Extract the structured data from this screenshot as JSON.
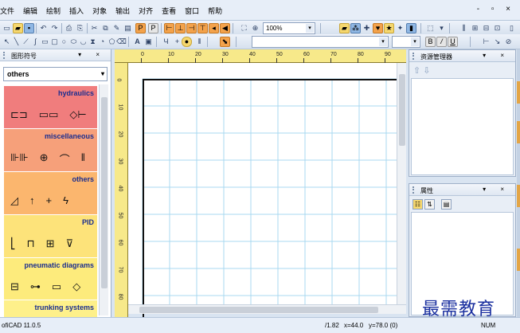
{
  "menu": {
    "items": [
      "文件",
      "编辑",
      "绘制",
      "插入",
      "对象",
      "输出",
      "对齐",
      "查看",
      "窗口",
      "帮助"
    ],
    "window_controls": "- ▫ ×"
  },
  "toolbar": {
    "zoom_value": "100%"
  },
  "left_panel": {
    "title": "图形符号",
    "controls": "▾ ×",
    "category_value": "others",
    "sections": [
      {
        "title": "hydraulics",
        "color": "#f07d7d",
        "symbols": [
          "⊏⊐",
          "▭▭",
          "◇⊢"
        ]
      },
      {
        "title": "miscellaneous",
        "color": "#f6a07a",
        "symbols": [
          "⊪⊪",
          "⊕",
          "⌒",
          "‖"
        ]
      },
      {
        "title": "others",
        "color": "#fbb66e",
        "symbols": [
          "◿",
          "↑",
          "+",
          "ϟ"
        ]
      },
      {
        "title": "PID",
        "color": "#fde37a",
        "symbols": [
          "⎣",
          "⊓",
          "⊞",
          "⊽"
        ]
      },
      {
        "title": "pneumatic diagrams",
        "color": "#fdeb7c",
        "symbols": [
          "⊟",
          "⊶",
          "▭",
          "◇"
        ]
      },
      {
        "title": "trunking systems",
        "color": "#fef08a",
        "symbols": []
      }
    ]
  },
  "ruler": {
    "top_labels": [
      "0",
      "10",
      "20",
      "30",
      "40",
      "50",
      "60",
      "70",
      "80",
      "90"
    ],
    "left_labels": [
      "0",
      "10",
      "20",
      "30",
      "40",
      "50",
      "60",
      "70",
      "80"
    ]
  },
  "right_panel_top": {
    "title": "资源管理器",
    "controls": "▾ ×"
  },
  "right_panel_bottom": {
    "title": "属性",
    "controls": "▾ ×"
  },
  "status": {
    "app": "ofiCAD 11.0.5",
    "page": "/1.82",
    "x": "x=44.0",
    "y": "y=78.0 (0)",
    "num": "NUM"
  },
  "watermark": "最需教育"
}
